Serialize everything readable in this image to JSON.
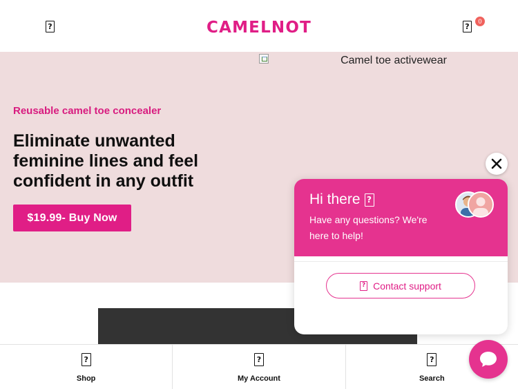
{
  "header": {
    "menu_icon": "missing-glyph",
    "logo_text": "CAMELNOT",
    "cart_icon": "missing-glyph",
    "cart_count": "0"
  },
  "hero": {
    "image_alt": "Camel toe activewear",
    "kicker": "Reusable camel toe concealer",
    "headline": "Eliminate unwanted feminine lines and feel confident in any outfit",
    "buy_button": "$19.99- Buy Now"
  },
  "bottom_nav": {
    "items": [
      {
        "label": "Shop",
        "icon": "missing-glyph"
      },
      {
        "label": "My Account",
        "icon": "missing-glyph"
      },
      {
        "label": "Search",
        "icon": "missing-glyph"
      }
    ]
  },
  "chat": {
    "greeting": "Hi there",
    "subtitle": "Have any questions? We're here to help!",
    "contact_button": "Contact support",
    "close_icon": "close-icon",
    "launcher_icon": "chat-bubble-icon"
  },
  "colors": {
    "brand": "#e01e86",
    "hero_bg": "#efdcdd",
    "chat_header": "#e5338f",
    "badge": "#f0625d",
    "dark_block": "#333333"
  }
}
